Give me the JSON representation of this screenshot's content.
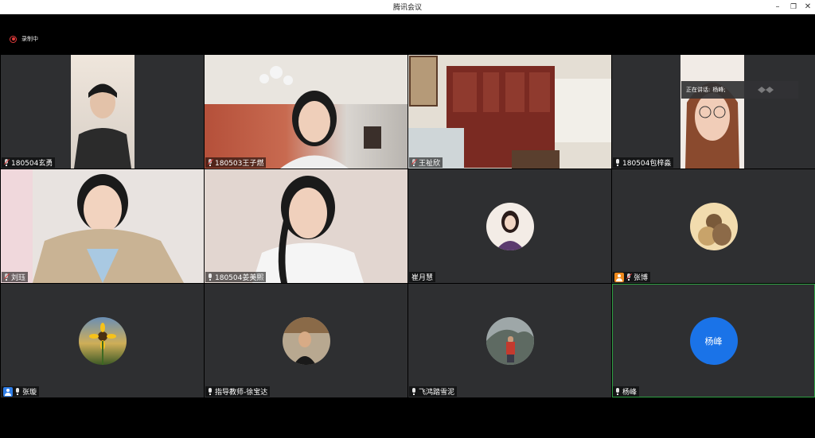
{
  "window": {
    "title": "腾讯会议",
    "minimize": "–",
    "restore": "❐",
    "close": "✕"
  },
  "recording": {
    "label": "录制中"
  },
  "speaking": {
    "prefix": "正在讲话:",
    "name": "杨峰;"
  },
  "participants": [
    {
      "name": "180504玄勇",
      "muted": true
    },
    {
      "name": "180503王子燃",
      "muted": true
    },
    {
      "name": "王祉欣",
      "muted": true
    },
    {
      "name": "180504包梓淼",
      "muted": false
    },
    {
      "name": "刘珏",
      "muted": true
    },
    {
      "name": "180504姜美熙",
      "muted": false
    },
    {
      "name": "崔月慧",
      "muted": false
    },
    {
      "name": "张博",
      "muted": true
    },
    {
      "name": "张璇",
      "muted": false
    },
    {
      "name": "指导教师-徐宝达",
      "muted": false
    },
    {
      "name": "飞鸿踏雪泥",
      "muted": false
    },
    {
      "name": "杨峰",
      "muted": false,
      "avatar_text": "杨峰"
    }
  ],
  "colors": {
    "accent": "#1a73e8",
    "active_border": "#2ea043",
    "tile_bg": "#2e2f31"
  }
}
